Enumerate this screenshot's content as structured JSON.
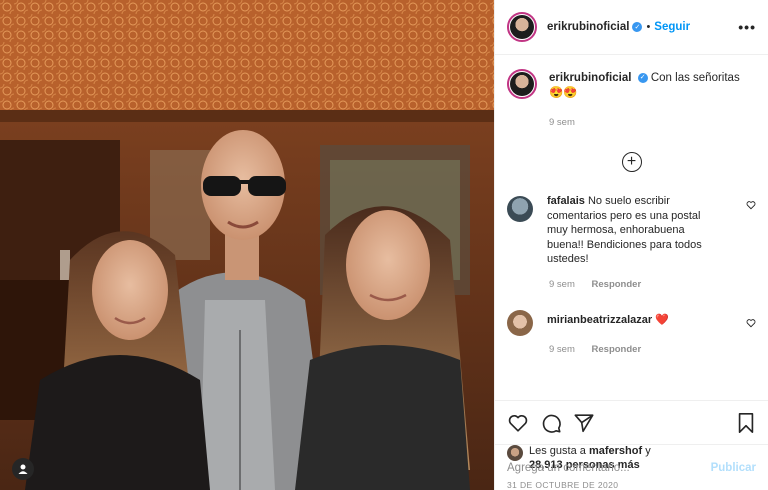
{
  "header": {
    "username": "erikrubinoficial",
    "separator": "•",
    "follow_label": "Seguir",
    "more_label": "•••"
  },
  "caption": {
    "username": "erikrubinoficial",
    "text": "Con las señoritas 😍😍",
    "time": "9 sem"
  },
  "load_more_label": "+",
  "comments": [
    {
      "username": "fafalais",
      "text": "No suelo escribir comentarios pero es una postal muy hermosa, enhorabuena buena!! Bendiciones para todos ustedes!",
      "time": "9 sem",
      "reply_label": "Responder"
    },
    {
      "username": "mirianbeatrizzalazar",
      "text": "❤️",
      "time": "9 sem",
      "reply_label": "Responder"
    }
  ],
  "likes": {
    "prefix": "Les gusta a",
    "user": "mafershof",
    "connector": "y",
    "count": "28,913 personas más"
  },
  "date": "31 DE OCTUBRE DE 2020",
  "add_comment": {
    "placeholder": "Agrega un comentario...",
    "publish_label": "Publicar"
  },
  "icons": {
    "verified": "verified-badge-icon",
    "like": "heart-icon",
    "comment": "comment-bubble-icon",
    "share": "paper-plane-icon",
    "save": "bookmark-icon",
    "tag": "user-tag-icon",
    "load_more": "plus-circle-icon"
  },
  "colors": {
    "accent": "#0095f6",
    "muted": "#8e8e8e",
    "publish_disabled": "#b2dffc",
    "verified": "#3897f0"
  }
}
